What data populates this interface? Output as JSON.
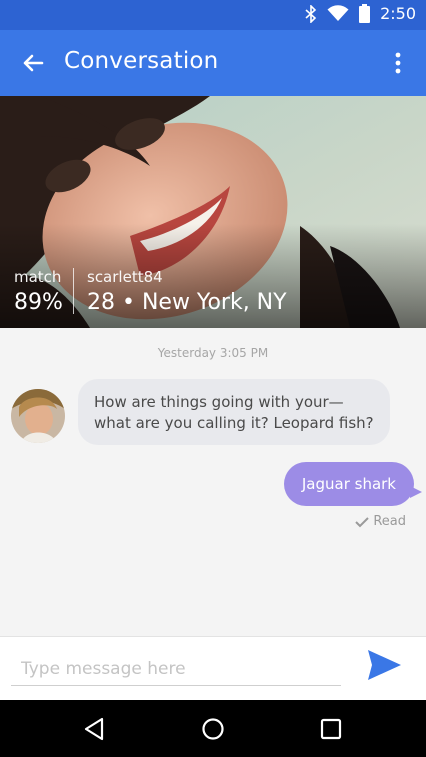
{
  "status_bar": {
    "time": "2:50"
  },
  "app_bar": {
    "title": "Conversation"
  },
  "profile": {
    "match_label": "match",
    "match_value": "89%",
    "username": "scarlett84",
    "age_location": "28 • New York, NY"
  },
  "conversation": {
    "timestamp": "Yesterday 3:05 PM",
    "incoming_message": "How are things going with your—what are you calling it? Leopard fish?",
    "outgoing_message": "Jaguar shark",
    "read_status": "Read"
  },
  "composer": {
    "placeholder": "Type message here",
    "value": ""
  },
  "colors": {
    "status_bar": "#2d63d2",
    "app_bar": "#3a77e6",
    "outgoing_bubble": "#9c8ce6",
    "incoming_bubble": "#e8e9ed",
    "send": "#3a77e6"
  }
}
